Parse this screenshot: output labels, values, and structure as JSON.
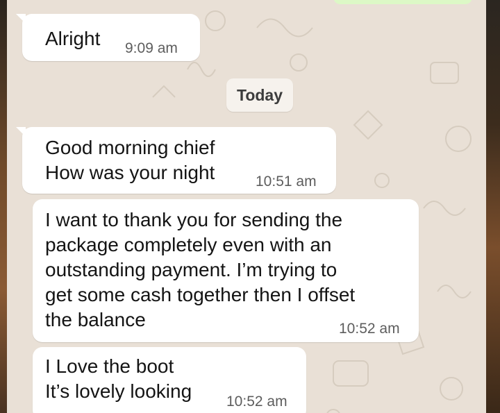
{
  "chat": {
    "date_divider": "Today",
    "messages": [
      {
        "text": "Alright",
        "time": "9:09 am"
      },
      {
        "text": "Good morning chief\nHow was your night",
        "time": "10:51 am"
      },
      {
        "text": "I want to thank you for sending the\npackage completely even with an\noutstanding payment. I’m trying to\nget some cash together then I offset\nthe balance",
        "time": "10:52 am"
      },
      {
        "text": "I Love the boot\nIt’s lovely looking",
        "time": "10:52 am"
      }
    ]
  },
  "colors": {
    "wallpaper": "#e9e0d6",
    "incoming_bubble": "#ffffff",
    "outgoing_bubble": "#dcf8c6",
    "timestamp": "#5d5d5d"
  }
}
